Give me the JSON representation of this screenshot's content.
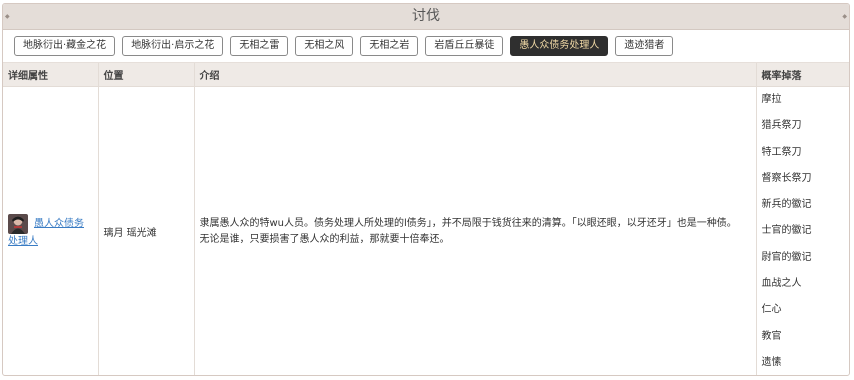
{
  "title": "讨伐",
  "tabs": [
    {
      "label": "地脉衍出·藏金之花",
      "active": false
    },
    {
      "label": "地脉衍出·启示之花",
      "active": false
    },
    {
      "label": "无相之雷",
      "active": false
    },
    {
      "label": "无相之风",
      "active": false
    },
    {
      "label": "无相之岩",
      "active": false
    },
    {
      "label": "岩盾丘丘暴徒",
      "active": false
    },
    {
      "label": "愚人众债务处理人",
      "active": true
    },
    {
      "label": "遗迹猎者",
      "active": false
    }
  ],
  "table": {
    "headers": [
      "详细属性",
      "位置",
      "介绍",
      "概率掉落"
    ],
    "row": {
      "enemy_name": "愚人众债务处理人",
      "location": "璃月 瑶光滩",
      "description": "隶属愚人众的特wu人员。债务处理人所处理的l债务」，并不局限于钱货往来的清算。「以眼还眼，以牙还牙」也是一种债。无论是谁，只要损害了愚人众的利益，那就要十倍奉还。",
      "drops": [
        "摩拉",
        "猎兵祭刀",
        "特工祭刀",
        "督察长祭刀",
        "新兵的徽记",
        "士官的徽记",
        "尉官的徽记",
        "血战之人",
        "仁心",
        "教官",
        "遗愫"
      ]
    }
  },
  "colors": {
    "active_tab_bg": "#2f2f2f",
    "active_tab_text": "#f0d9a6",
    "link": "#3a7cc4",
    "header_bg": "#efeae6"
  }
}
